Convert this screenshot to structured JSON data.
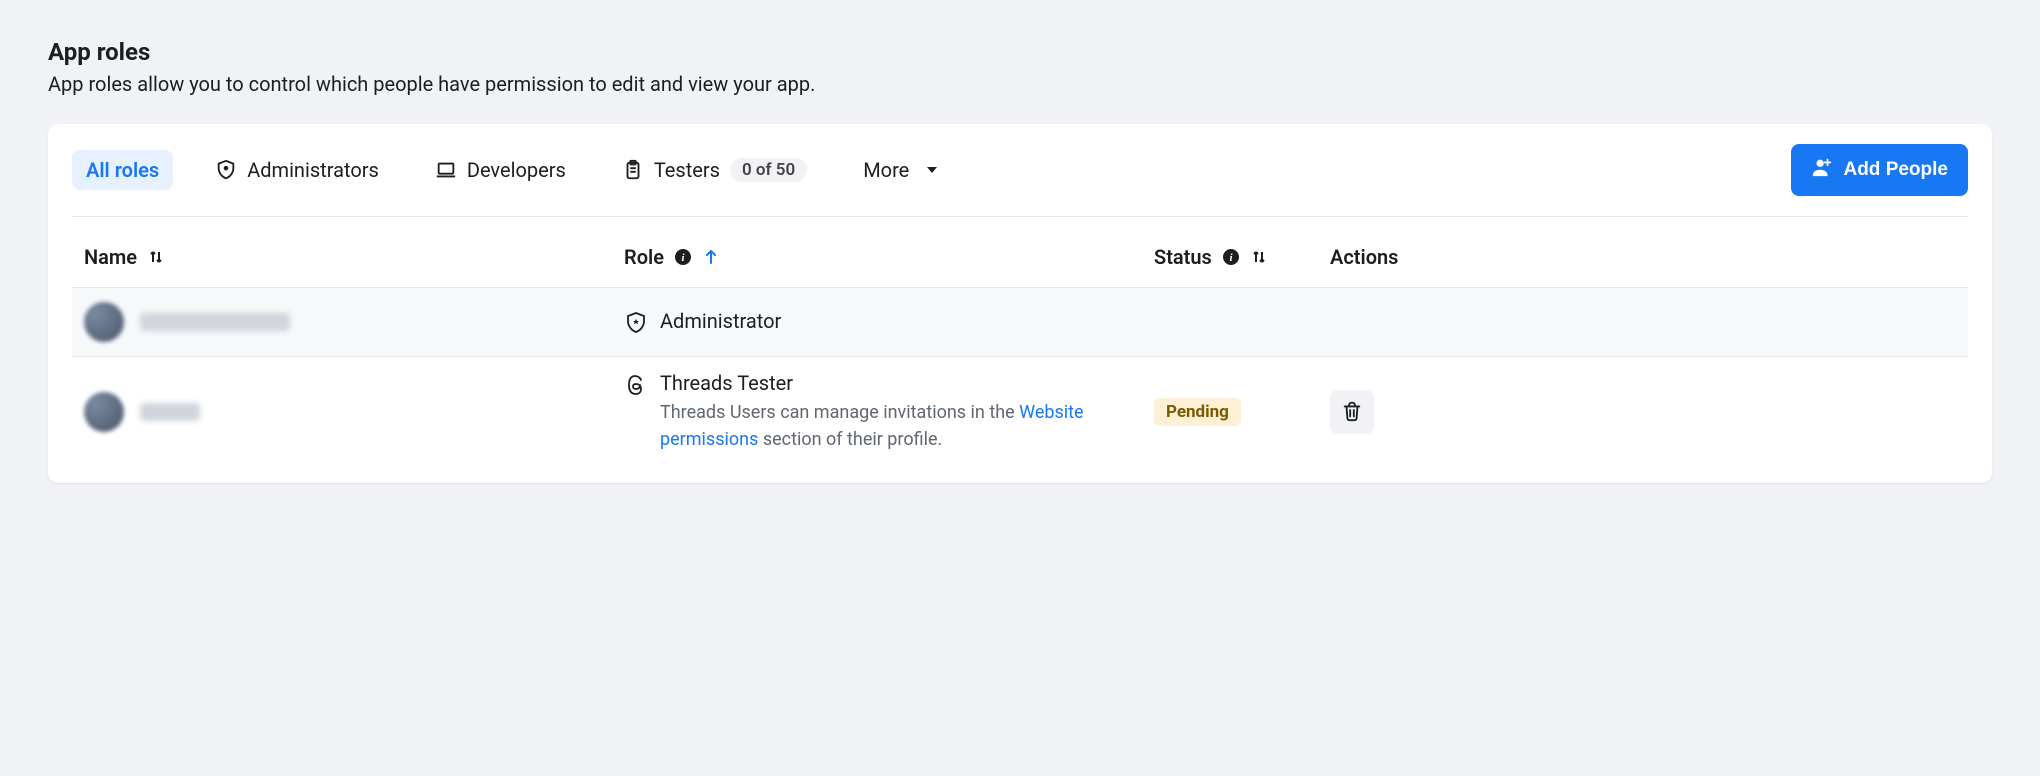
{
  "header": {
    "title": "App roles",
    "description": "App roles allow you to control which people have permission to edit and view your app."
  },
  "tabs": {
    "all_roles": "All roles",
    "administrators": "Administrators",
    "developers": "Developers",
    "testers": "Testers",
    "testers_count": "0 of 50",
    "more": "More"
  },
  "actions": {
    "add_people": "Add People"
  },
  "columns": {
    "name": "Name",
    "role": "Role",
    "status": "Status",
    "actions": "Actions"
  },
  "rows": [
    {
      "role_name": "Administrator",
      "role_icon": "shield",
      "status": "",
      "has_delete": false,
      "sub_pre": "",
      "sub_link": "",
      "sub_post": ""
    },
    {
      "role_name": "Threads Tester",
      "role_icon": "threads",
      "status": "Pending",
      "has_delete": true,
      "sub_pre": "Threads Users can manage invitations in the ",
      "sub_link": "Website permissions",
      "sub_post": " section of their profile."
    }
  ]
}
